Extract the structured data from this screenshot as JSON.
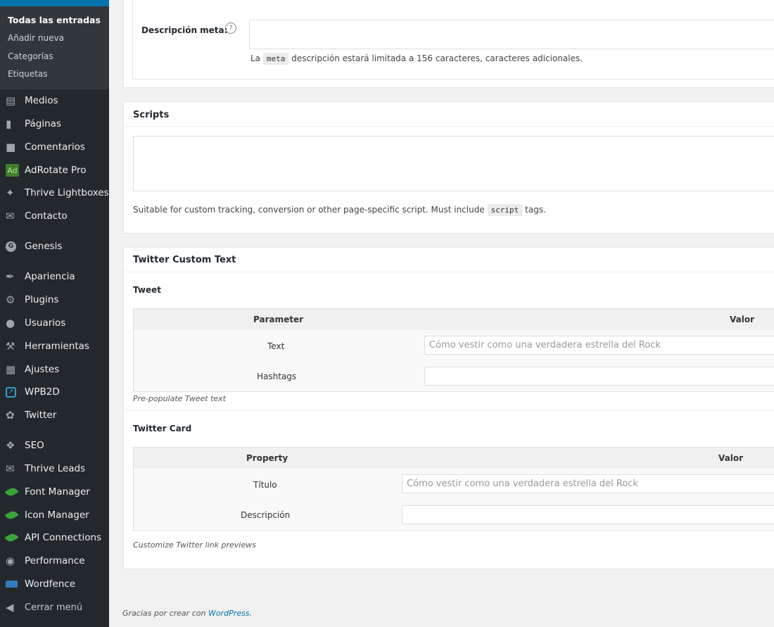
{
  "sidebar": {
    "submenu": [
      "Todas las entradas",
      "Añadir nueva",
      "Categorías",
      "Etiquetas"
    ],
    "items": [
      {
        "label": "Medios",
        "icon": "media-icon"
      },
      {
        "label": "Páginas",
        "icon": "pages-icon"
      },
      {
        "label": "Comentarios",
        "icon": "comments-icon"
      },
      {
        "label": "AdRotate Pro",
        "icon": "adrotate-icon",
        "icon_text": "Ad"
      },
      {
        "label": "Thrive Lightboxes",
        "icon": "pin-icon"
      },
      {
        "label": "Contacto",
        "icon": "mail-icon"
      },
      {
        "label": "Genesis",
        "icon": "genesis-icon",
        "icon_text": "G"
      },
      {
        "label": "Apariencia",
        "icon": "paintbrush-icon"
      },
      {
        "label": "Plugins",
        "icon": "plugin-icon"
      },
      {
        "label": "Usuarios",
        "icon": "user-icon"
      },
      {
        "label": "Herramientas",
        "icon": "wrench-icon"
      },
      {
        "label": "Ajustes",
        "icon": "settings-icon"
      },
      {
        "label": "WPB2D",
        "icon": "wpb2d-icon"
      },
      {
        "label": "Twitter",
        "icon": "twitter-icon"
      },
      {
        "label": "SEO",
        "icon": "seo-icon"
      },
      {
        "label": "Thrive Leads",
        "icon": "thrive-leads-icon"
      },
      {
        "label": "Font Manager",
        "icon": "leaf-icon"
      },
      {
        "label": "Icon Manager",
        "icon": "leaf-icon"
      },
      {
        "label": "API Connections",
        "icon": "leaf-icon"
      },
      {
        "label": "Performance",
        "icon": "performance-icon"
      },
      {
        "label": "Wordfence",
        "icon": "wordfence-icon"
      },
      {
        "label": "Cerrar menú",
        "icon": "collapse-icon"
      }
    ]
  },
  "meta_panel": {
    "label": "Descripción meta:",
    "help": "?",
    "input_value": "",
    "desc_before": "La",
    "desc_code": "meta",
    "desc_after": "descripción estará limitada a 156 caracteres, caracteres adicionales."
  },
  "scripts_panel": {
    "title": "Scripts",
    "textarea_value": "",
    "desc_before": "Suitable for custom tracking, conversion or other page-specific script. Must include",
    "desc_code": "script",
    "desc_after": "tags."
  },
  "twitter_panel": {
    "title": "Twitter Custom Text",
    "tweet": {
      "heading": "Tweet",
      "col_param": "Parameter",
      "col_value": "Valor",
      "rows": [
        {
          "label": "Text",
          "placeholder": "Cómo vestir como una verdadera estrella del Rock"
        },
        {
          "label": "Hashtags",
          "placeholder": ""
        }
      ],
      "note": "Pre-populate Tweet text"
    },
    "card": {
      "heading": "Twitter Card",
      "col_param": "Property",
      "col_value": "Valor",
      "rows": [
        {
          "label": "Título",
          "placeholder": "Cómo vestir como una verdadera estrella del Rock"
        },
        {
          "label": "Descripción",
          "placeholder": ""
        }
      ],
      "note": "Customize Twitter link previews"
    }
  },
  "footer": {
    "text_before": "Gracias por crear con",
    "link": "WordPress",
    "text_after": "."
  }
}
